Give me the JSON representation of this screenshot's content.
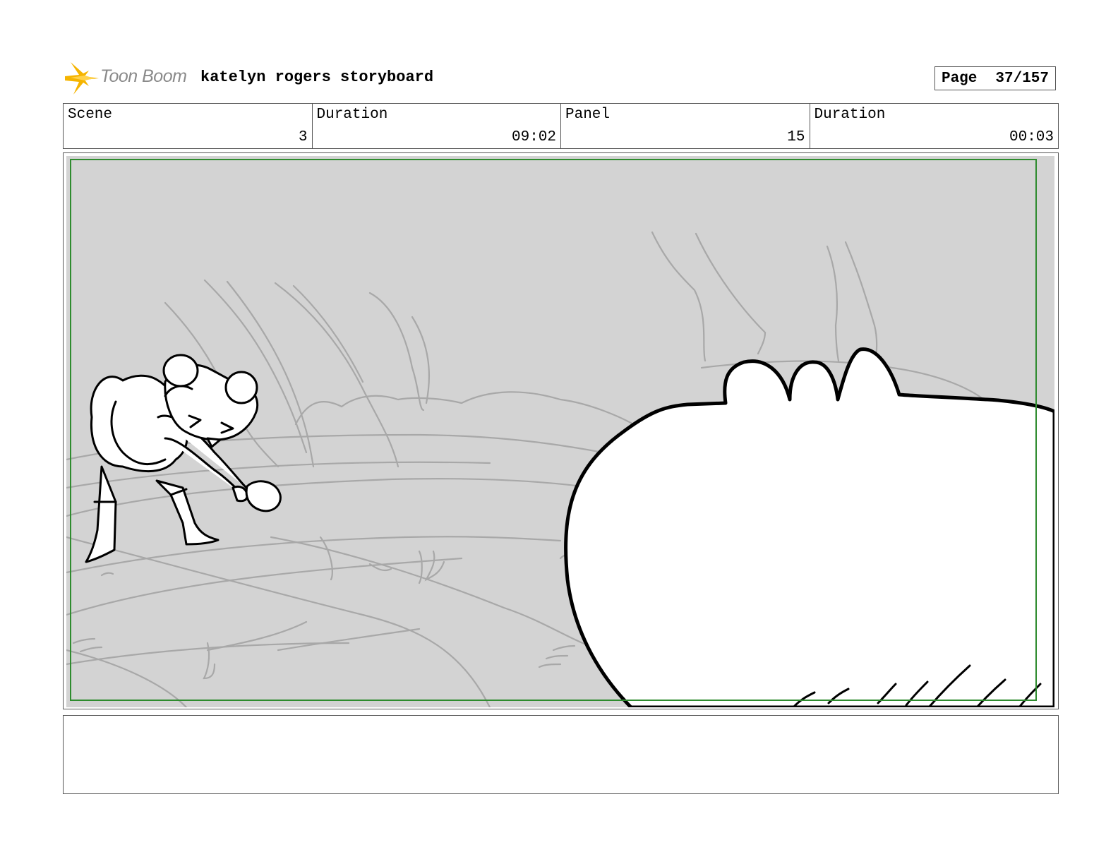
{
  "header": {
    "logo_text": "Toon Boom",
    "storyboard_title": "katelyn rogers storyboard",
    "page_label": "Page",
    "page_number": "37/157"
  },
  "info": {
    "scene_label": "Scene",
    "scene_value": "3",
    "scene_duration_label": "Duration",
    "scene_duration_value": "09:02",
    "panel_label": "Panel",
    "panel_value": "15",
    "panel_duration_label": "Duration",
    "panel_duration_value": "00:03"
  },
  "colors": {
    "background_sketch": "#d3d3d3",
    "safe_frame": "#2e8b2e",
    "logo_flare": "#f5b400"
  }
}
